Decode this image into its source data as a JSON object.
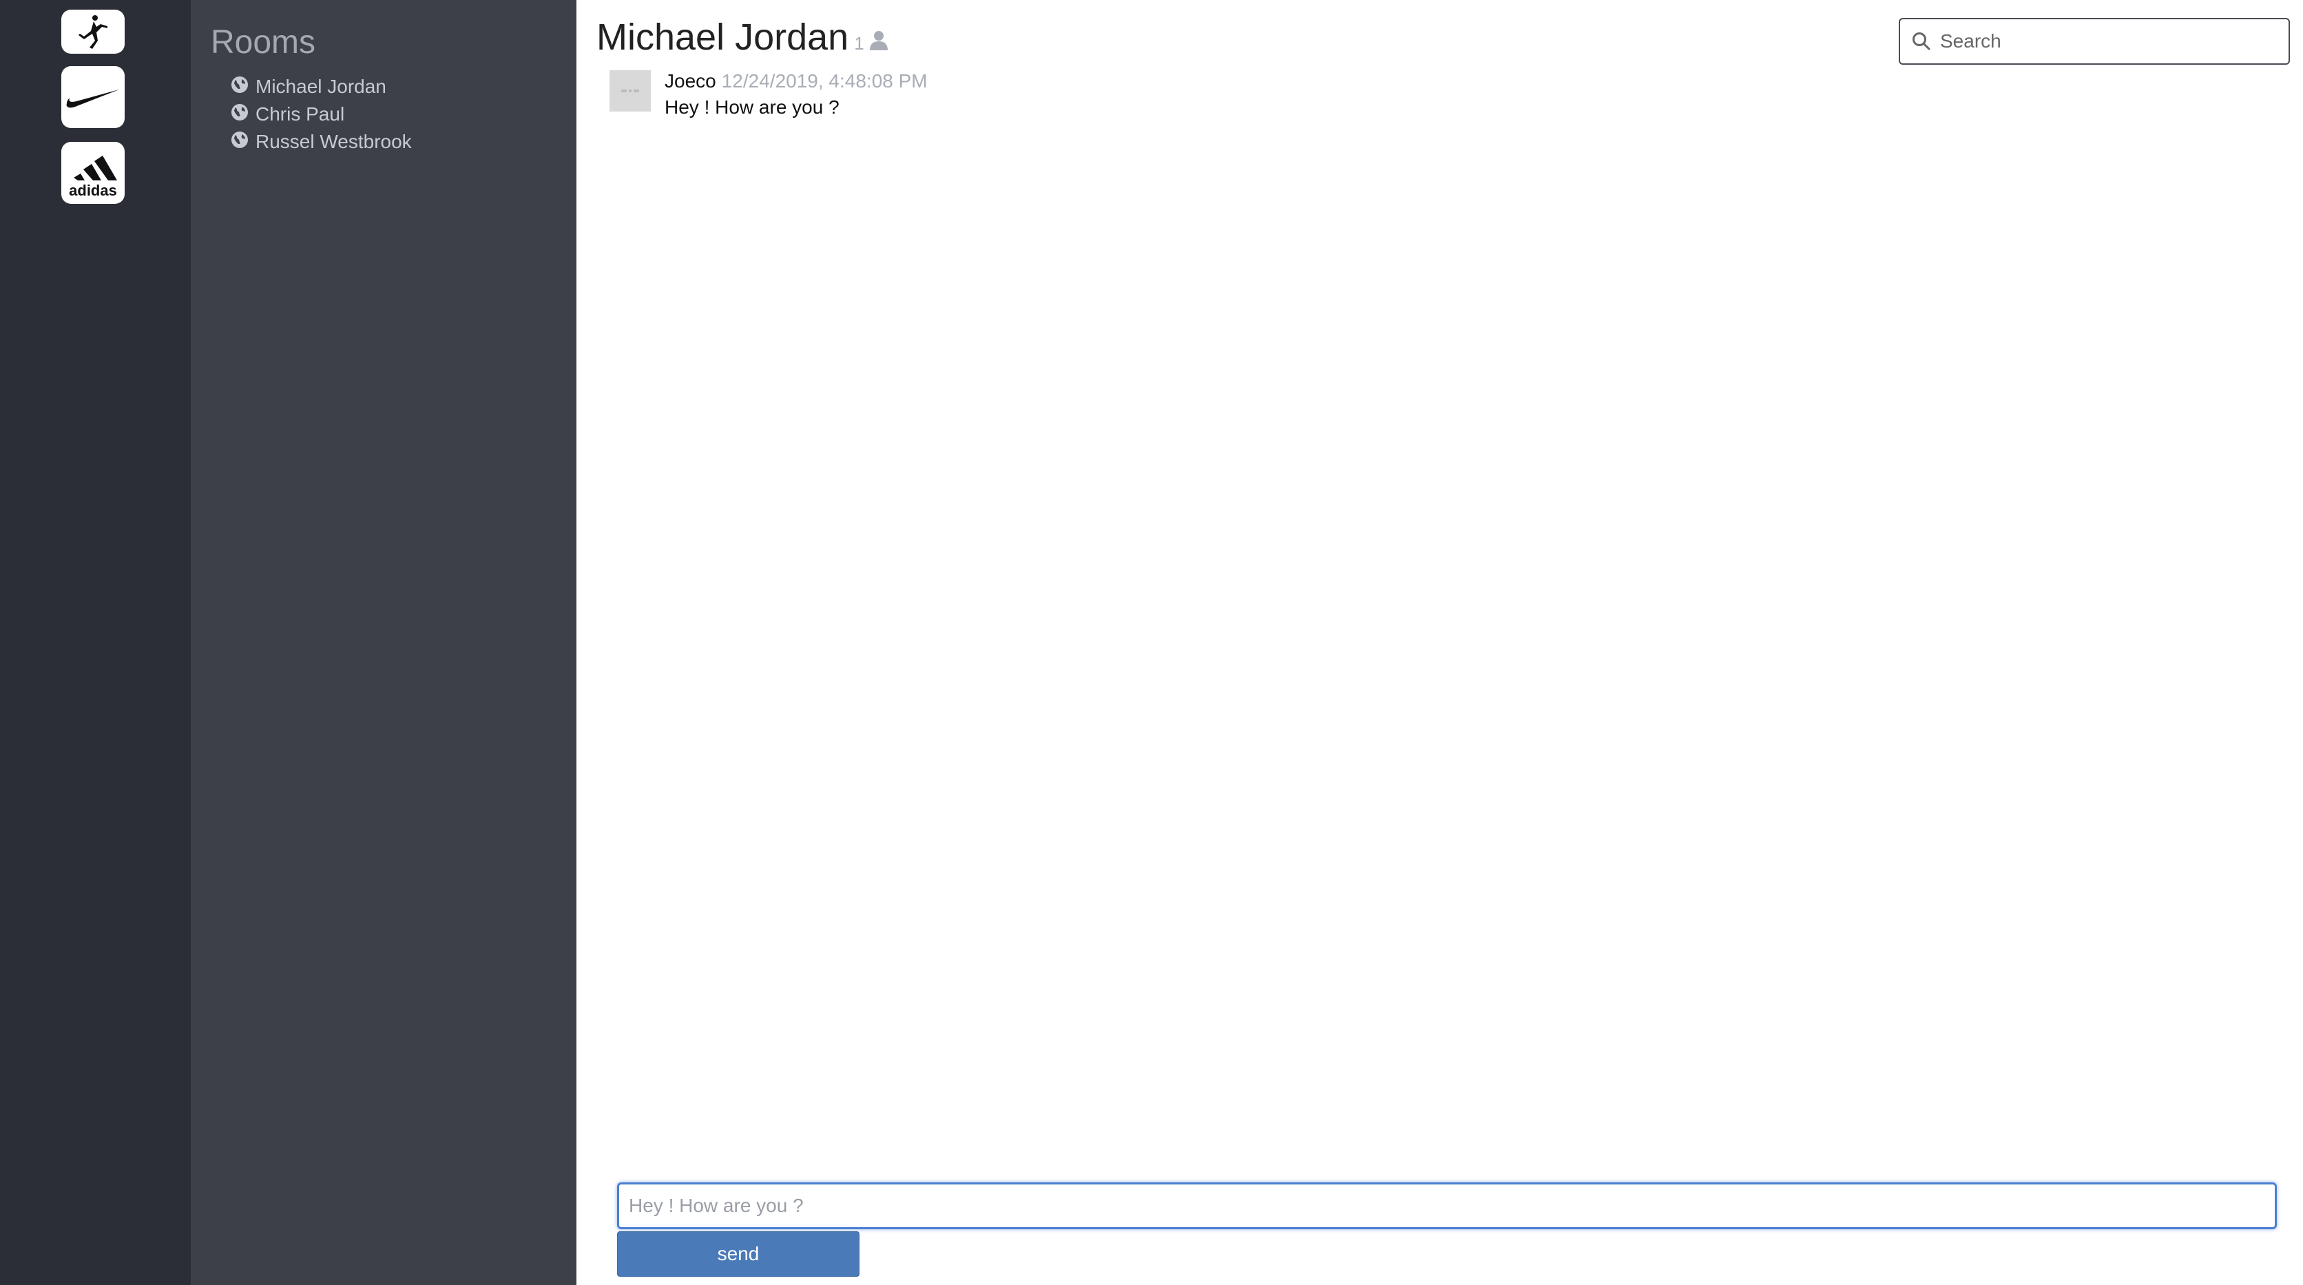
{
  "workspaces": [
    {
      "name": "Jordan",
      "icon": "jumpman-logo-icon"
    },
    {
      "name": "Nike",
      "icon": "nike-swoosh-icon"
    },
    {
      "name": "adidas",
      "icon": "adidas-logo-icon"
    }
  ],
  "sidebar": {
    "title": "Rooms",
    "rooms": [
      {
        "label": "Michael Jordan",
        "icon": "globe-icon"
      },
      {
        "label": "Chris Paul",
        "icon": "globe-icon"
      },
      {
        "label": "Russel Westbrook",
        "icon": "globe-icon"
      }
    ]
  },
  "chat": {
    "title": "Michael Jordan",
    "member_count": "1",
    "search_placeholder": "Search",
    "messages": [
      {
        "author": "Joeco",
        "timestamp": "12/24/2019, 4:48:08 PM",
        "text": "Hey ! How are you ?"
      }
    ],
    "composer_value": "Hey ! How are you ?",
    "send_label": "send"
  },
  "colors": {
    "rail": "#2b2e36",
    "sidebar": "#3d4047",
    "accent": "#4a7ab8"
  }
}
